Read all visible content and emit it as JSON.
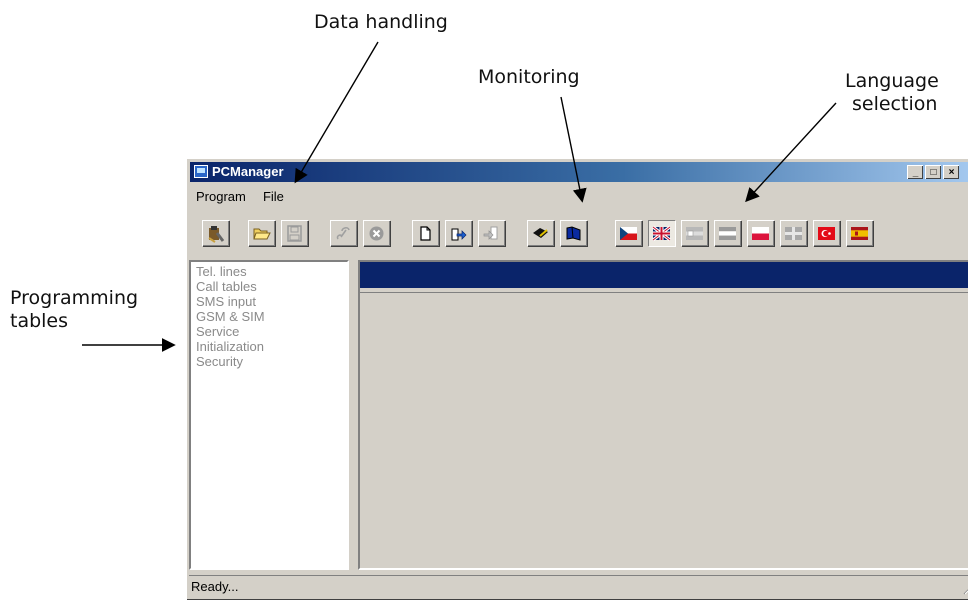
{
  "callouts": {
    "data_handling": "Data handling",
    "monitoring": "Monitoring",
    "language_line1": "Language",
    "language_line2": "selection",
    "programming_line1": "Programming",
    "programming_line2": "tables"
  },
  "window": {
    "title": "PCManager",
    "minimize": "_",
    "maximize": "□",
    "close": "×"
  },
  "menu": {
    "items": [
      "Program",
      "File"
    ]
  },
  "toolbar": {
    "buttons": [
      {
        "name": "program-settings-button",
        "icon": "tools-icon"
      },
      {
        "name": "open-button",
        "icon": "folder-open-icon"
      },
      {
        "name": "save-button",
        "icon": "floppy-disk-icon"
      },
      {
        "name": "connect-button",
        "icon": "link-icon"
      },
      {
        "name": "disconnect-button",
        "icon": "cancel-icon"
      },
      {
        "name": "new-file-button",
        "icon": "new-document-icon"
      },
      {
        "name": "export-button",
        "icon": "export-icon"
      },
      {
        "name": "import-button",
        "icon": "import-icon"
      },
      {
        "name": "monitor-write-button",
        "icon": "pencil-book-icon"
      },
      {
        "name": "monitor-read-button",
        "icon": "book-icon"
      },
      {
        "name": "lang-czech-button",
        "icon": "czech-flag-icon"
      },
      {
        "name": "lang-english-button",
        "icon": "uk-flag-icon",
        "selected": true
      },
      {
        "name": "lang-german-button",
        "icon": "flag-icon"
      },
      {
        "name": "lang-lang4-button",
        "icon": "flag-icon"
      },
      {
        "name": "lang-polish-button",
        "icon": "polish-flag-icon"
      },
      {
        "name": "lang-lang6-button",
        "icon": "cross-flag-icon"
      },
      {
        "name": "lang-turkish-button",
        "icon": "turkish-flag-icon"
      },
      {
        "name": "lang-spanish-button",
        "icon": "spanish-flag-icon"
      }
    ]
  },
  "tree": {
    "items": [
      "Tel. lines",
      "Call tables",
      "SMS input",
      "GSM & SIM",
      "Service",
      "Initialization",
      "Security"
    ]
  },
  "status": {
    "text": "Ready..."
  },
  "colors": {
    "header_bar": "#0a246a",
    "face": "#d4d0c8",
    "disabled_text": "#8a8a8a"
  }
}
